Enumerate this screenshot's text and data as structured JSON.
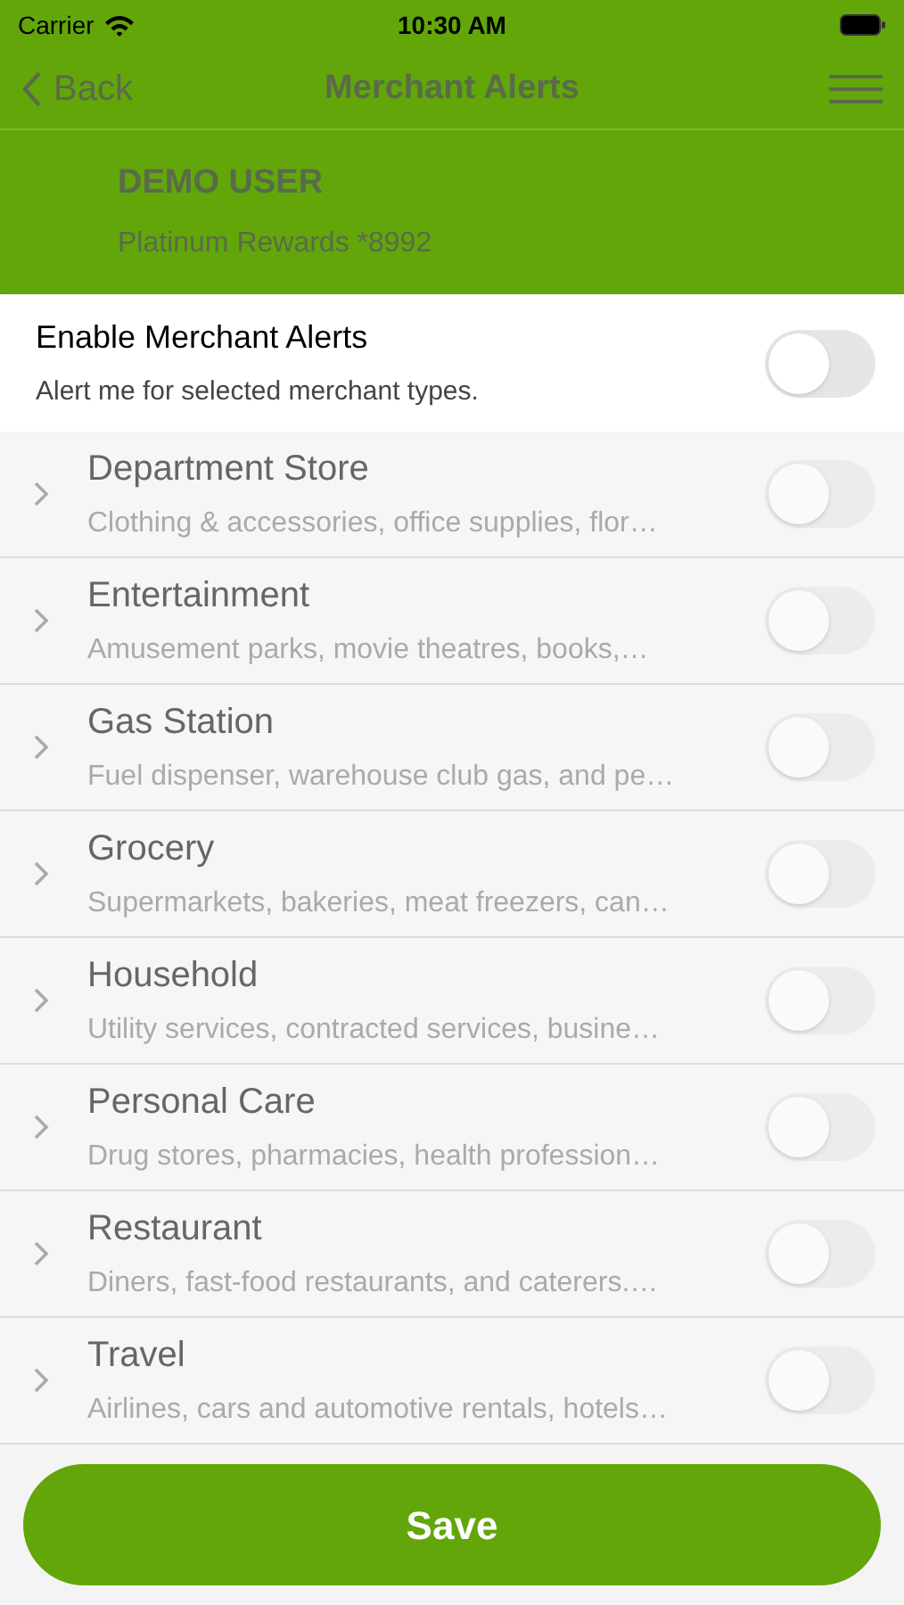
{
  "status_bar": {
    "carrier": "Carrier",
    "time": "10:30 AM"
  },
  "nav": {
    "back": "Back",
    "title": "Merchant Alerts"
  },
  "account": {
    "name": "DEMO USER",
    "card": "Platinum Rewards *8992"
  },
  "master": {
    "title": "Enable Merchant Alerts",
    "subtitle": "Alert me for selected merchant types.",
    "on": false
  },
  "categories": [
    {
      "title": "Department Store",
      "subtitle": "Clothing & accessories, office supplies, flor…",
      "on": false,
      "disabled": true
    },
    {
      "title": "Entertainment",
      "subtitle": "Amusement parks, movie theatres, books,…",
      "on": false,
      "disabled": true
    },
    {
      "title": "Gas Station",
      "subtitle": "Fuel dispenser, warehouse club gas, and pe…",
      "on": false,
      "disabled": true
    },
    {
      "title": "Grocery",
      "subtitle": "Supermarkets, bakeries, meat freezers, can…",
      "on": false,
      "disabled": true
    },
    {
      "title": "Household",
      "subtitle": "Utility services, contracted services, busine…",
      "on": false,
      "disabled": true
    },
    {
      "title": "Personal Care",
      "subtitle": "Drug stores, pharmacies, health profession…",
      "on": false,
      "disabled": true
    },
    {
      "title": "Restaurant",
      "subtitle": "Diners, fast-food restaurants, and caterers.…",
      "on": false,
      "disabled": true
    },
    {
      "title": "Travel",
      "subtitle": "Airlines, cars and automotive rentals, hotels…",
      "on": false,
      "disabled": true
    }
  ],
  "save_button": "Save"
}
